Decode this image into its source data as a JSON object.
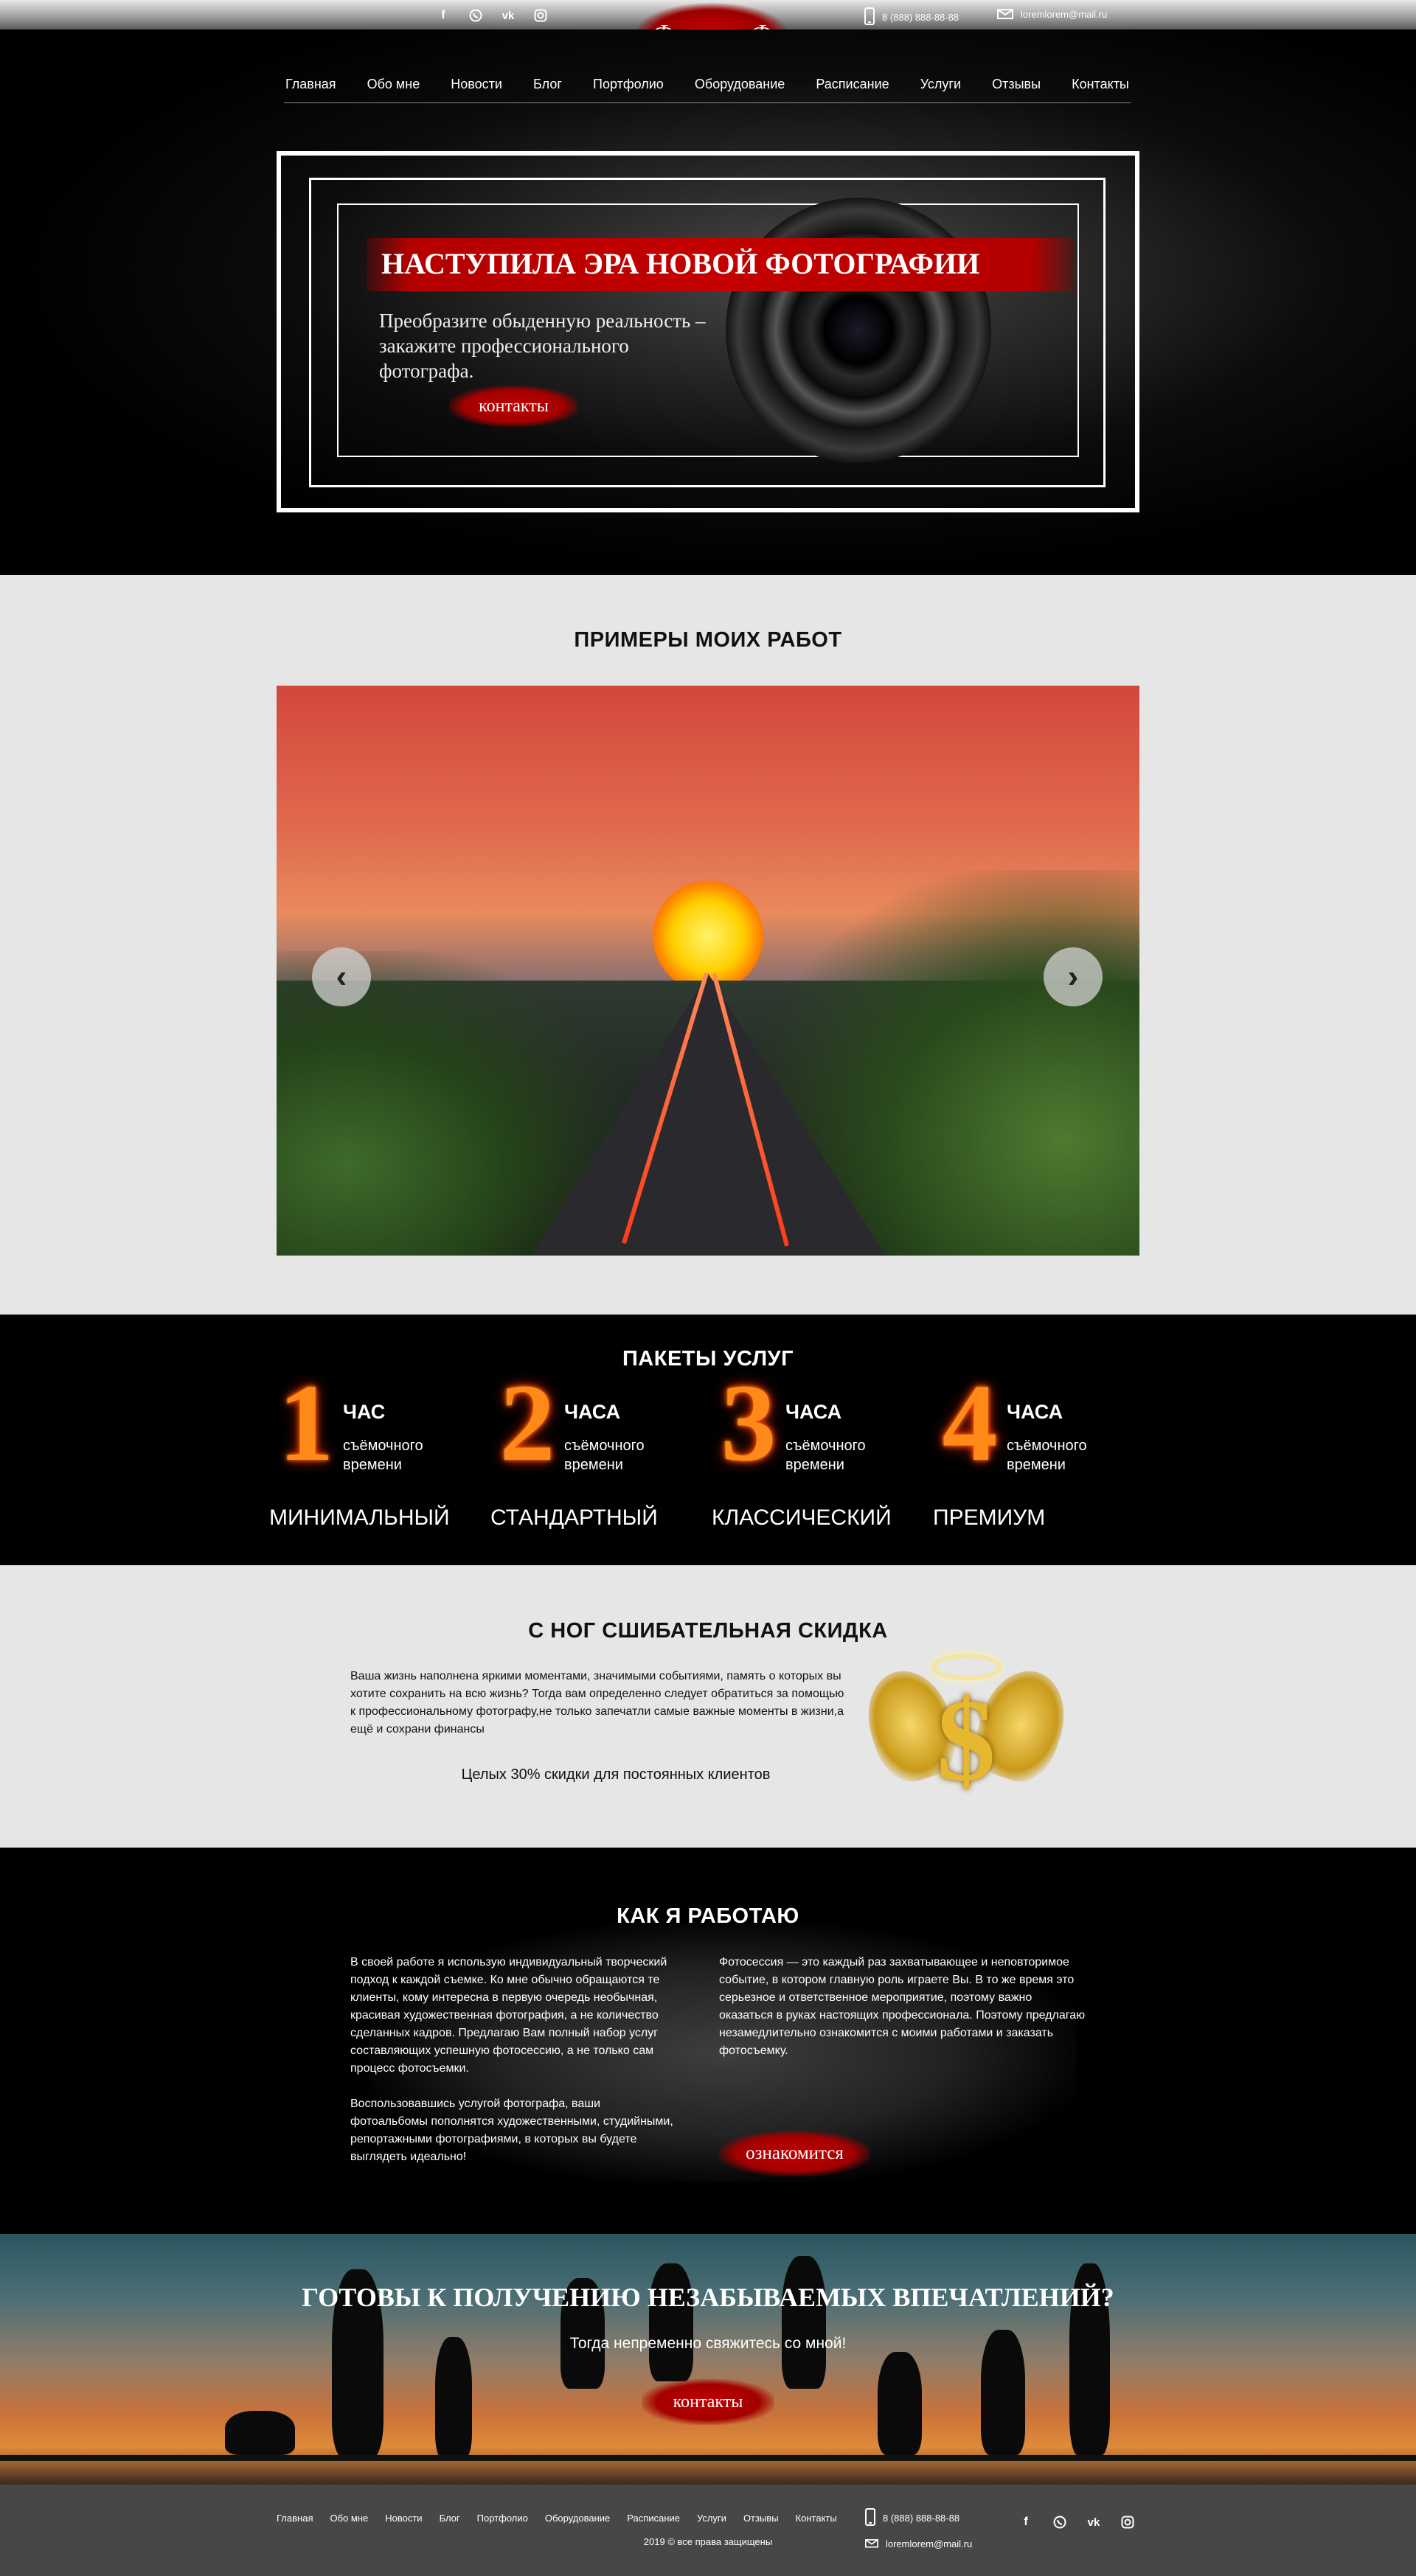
{
  "topbar": {
    "social": [
      "facebook-icon",
      "whatsapp-icon",
      "vk-icon",
      "instagram-icon"
    ],
    "phone": "8 (888) 888-88-88",
    "email": "loremlorem@mail.ru",
    "logo": "ФотограФ"
  },
  "nav": {
    "items": [
      "Главная",
      "Обо мне",
      "Новости",
      "Блог",
      "Портфолио",
      "Оборудование",
      "Расписание",
      "Услуги",
      "Отзывы",
      "Контакты"
    ]
  },
  "hero": {
    "headline": "НАСТУПИЛА ЭРА НОВОЙ ФОТОГРАФИИ",
    "subtitle_line1": "Преобразите обыденную реальность –",
    "subtitle_line2": "закажите профессионального",
    "subtitle_line3": "фотографа.",
    "button": "контакты"
  },
  "works": {
    "title": "ПРИМЕРЫ МОИХ РАБОТ",
    "prev_icon": "chevron-left-icon",
    "next_icon": "chevron-right-icon"
  },
  "packages": {
    "title": "ПАКЕТЫ УСЛУГ",
    "items": [
      {
        "number": "1",
        "unit": "ЧАС",
        "desc_line1": "съёмочного",
        "desc_line2": "времени",
        "name": "МИНИМАЛЬНЫЙ"
      },
      {
        "number": "2",
        "unit": "ЧАСА",
        "desc_line1": "съёмочного",
        "desc_line2": "времени",
        "name": "СТАНДАРТНЫЙ"
      },
      {
        "number": "3",
        "unit": "ЧАСА",
        "desc_line1": "съёмочного",
        "desc_line2": "времени",
        "name": "КЛАССИЧЕСКИЙ"
      },
      {
        "number": "4",
        "unit": "ЧАСА",
        "desc_line1": "съёмочного",
        "desc_line2": "времени",
        "name": "ПРЕМИУМ"
      }
    ]
  },
  "discount": {
    "title": "С НОГ СШИБАТЕЛЬНАЯ СКИДКА",
    "text": "Ваша жизнь наполнена яркими моментами, значимыми событиями, память о которых вы хотите сохранить на всю жизнь? Тогда вам определенно следует обратиться за помощью к профессиональному фотографу,не только запечатли самые важные моменты в жизни,а ещё и сохрани финансы",
    "offer": "Целых 30% скидки для постоянных клиентов"
  },
  "how": {
    "title": "КАК Я РАБОТАЮ",
    "left_p1": "В своей работе я использую индивидуальный творческий подход к каждой съемке. Ко мне обычно обращаются те клиенты, кому интересна в первую очередь необычная, красивая художественная фотография, а не количество сделанных кадров. Предлагаю Вам полный набор услуг составляющих успешную фотосессию, а не только сам процесс фотосъемки.",
    "left_p2": "Воспользовавшись услугой фотографа, ваши фотоальбомы пополнятся художественными, студийными, репортажными фотографиями, в которых вы будете выглядеть идеально!",
    "right_p1": "Фотосессия — это каждый раз захватывающее и неповторимое событие, в котором главную роль играете Вы. В то же время это серьезное и ответственное мероприятие, поэтому важно оказаться в руках настоящих профессионала. Поэтому предлагаю незамедлительно ознакомится с моими работами и заказать фотосъемку.",
    "button": "ознакомится"
  },
  "cta": {
    "title": "ГОТОВЫ К ПОЛУЧЕНИЮ НЕЗАБЫВАЕМЫХ ВПЕЧАТЛЕНИЙ?",
    "subtitle": "Тогда непременно свяжитесь со мной!",
    "button": "контакты"
  },
  "footer": {
    "nav": [
      "Главная",
      "Обо мне",
      "Новости",
      "Блог",
      "Портфолио",
      "Оборудование",
      "Расписание",
      "Услуги",
      "Отзывы",
      "Контакты"
    ],
    "copyright": "2019 © все права защищены",
    "phone": "8 (888) 888-88-88",
    "email": "loremlorem@mail.ru"
  }
}
